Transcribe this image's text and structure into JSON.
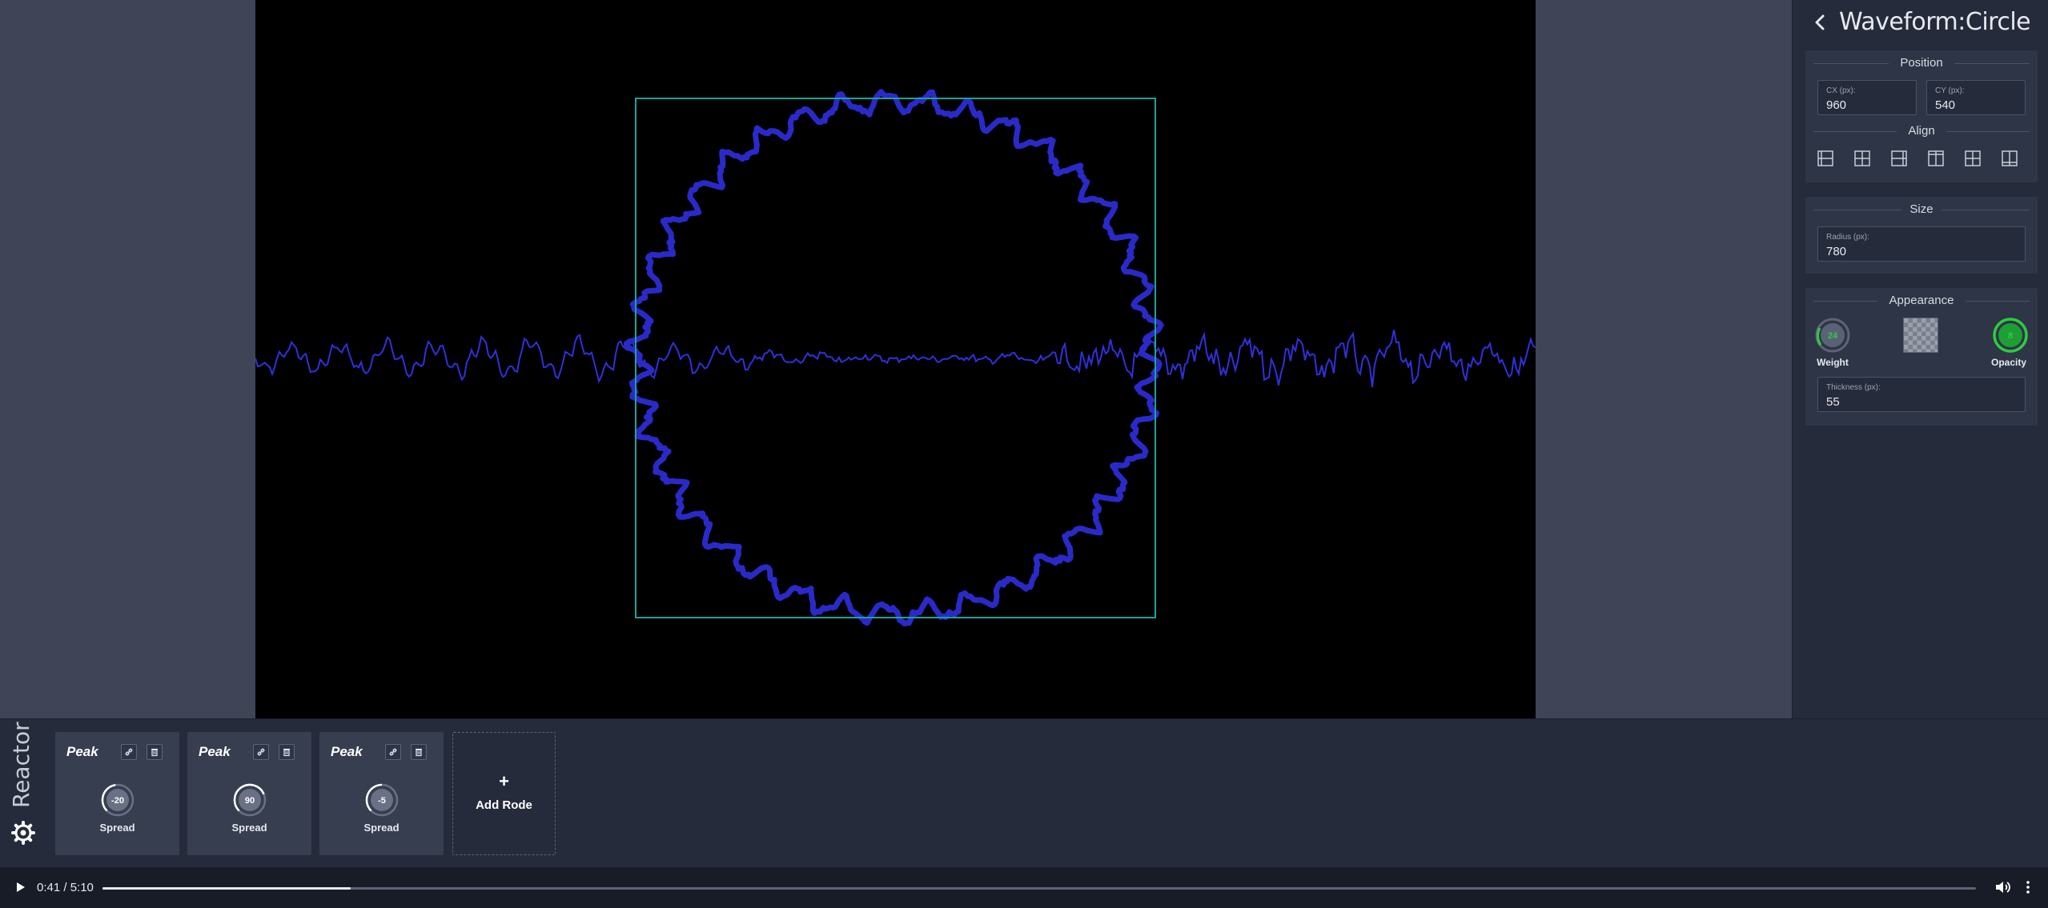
{
  "panel": {
    "title": "Waveform:Circle",
    "back_icon": "chevron-left-icon",
    "position": {
      "heading": "Position",
      "cx_label": "CX (px):",
      "cx_value": "960",
      "cy_label": "CY (px):",
      "cy_value": "540"
    },
    "align": {
      "heading": "Align",
      "buttons": [
        "align-left-icon",
        "align-center-h-icon",
        "align-right-icon",
        "align-top-icon",
        "align-center-v-icon",
        "align-bottom-icon"
      ]
    },
    "size": {
      "heading": "Size",
      "radius_label": "Radius (px):",
      "radius_value": "780"
    },
    "appearance": {
      "heading": "Appearance",
      "weight_value": "24",
      "weight_label": "Weight",
      "opacity_value": "8",
      "opacity_label": "Opacity",
      "thickness_label": "Thickness (px):",
      "thickness_value": "55",
      "accent_color": "#2ecc40",
      "swatch_icon": "transparent-swatch-icon"
    }
  },
  "reactor": {
    "title": "Reactor",
    "gear_icon": "gear-icon",
    "nodes": [
      {
        "title": "Peak",
        "value": "-20",
        "label": "Spread",
        "fraction": 0.47
      },
      {
        "title": "Peak",
        "value": "90",
        "label": "Spread",
        "fraction": 0.75
      },
      {
        "title": "Peak",
        "value": "-5",
        "label": "Spread",
        "fraction": 0.5
      }
    ],
    "add_plus": "+",
    "add_label": "Add Rode"
  },
  "player": {
    "time": "0:41 / 5:10",
    "progress": 0.1323,
    "play_icon": "play-icon",
    "volume_icon": "volume-icon",
    "more_icon": "more-vertical-icon"
  },
  "colors": {
    "waveform": "#2f2fd6",
    "selection_box": "#1aa39a",
    "canvas_bg": "#000000",
    "panel_bg": "#252b3b"
  }
}
